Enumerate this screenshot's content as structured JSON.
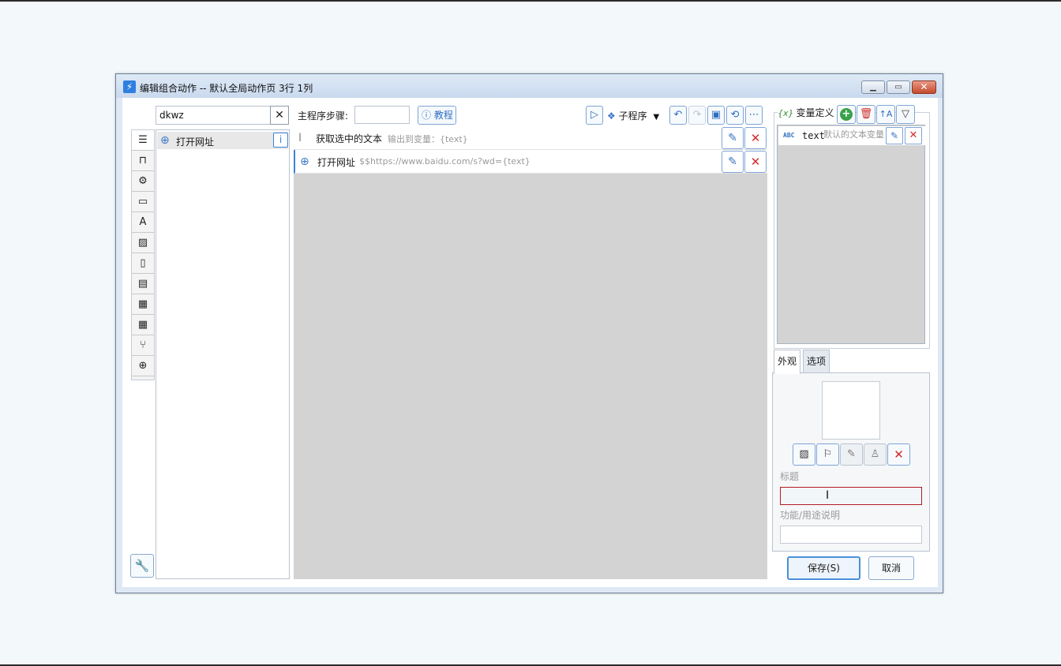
{
  "window": {
    "title": "编辑组合动作 -- 默认全局动作页 3行 1列"
  },
  "palette": {
    "search_value": "dkwz",
    "clear_glyph": "✕",
    "categories": [
      {
        "icon": "list-icon",
        "glyph": "☰"
      },
      {
        "icon": "bookmark-icon",
        "glyph": "⊓"
      },
      {
        "icon": "gear-icon",
        "glyph": "⚙"
      },
      {
        "icon": "window-icon",
        "glyph": "▭"
      },
      {
        "icon": "text-icon",
        "glyph": "A"
      },
      {
        "icon": "image-icon",
        "glyph": "▨"
      },
      {
        "icon": "clipboard-icon",
        "glyph": "▯"
      },
      {
        "icon": "document-icon",
        "glyph": "▤"
      },
      {
        "icon": "windows-icon",
        "glyph": "▦"
      },
      {
        "icon": "calculator-icon",
        "glyph": "▦"
      },
      {
        "icon": "branch-icon",
        "glyph": "⑂"
      },
      {
        "icon": "globe-icon",
        "glyph": "⊕"
      }
    ],
    "items": [
      {
        "label": "打开网址"
      }
    ],
    "tool_glyph": "🔧"
  },
  "editor": {
    "steps_label": "主程序步骤:",
    "tutorial_label": "ⓘ 教程",
    "subprogram_label": "子程序",
    "steps": [
      {
        "title": "获取选中的文本",
        "desc": "输出到变量：{text}",
        "icon": "text-cursor-icon"
      },
      {
        "title": "打开网址",
        "desc": "$$https://www.baidu.com/s?wd={text}",
        "icon": "globe-icon"
      }
    ]
  },
  "variables": {
    "header": "变量定义",
    "items": [
      {
        "type": "ABC",
        "name": "text",
        "desc": "默认的文本变量"
      }
    ]
  },
  "appearance": {
    "tabs": [
      "外观",
      "选项"
    ],
    "title_label": "标题",
    "title_value": "",
    "desc_label": "功能/用途说明",
    "desc_value": ""
  },
  "footer": {
    "save_label": "保存(S)",
    "cancel_label": "取消"
  }
}
